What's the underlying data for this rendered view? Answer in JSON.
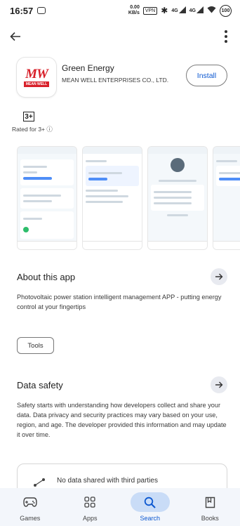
{
  "status_bar": {
    "time": "16:57",
    "net_speed_top": "0.00",
    "net_speed_bottom": "KB/s",
    "vpn": "VPN",
    "signal_1": "4G",
    "signal_2": "4G",
    "battery": "100"
  },
  "app": {
    "name": "Green Energy",
    "developer": "MEAN WELL ENTERPRISES CO., LTD.",
    "logo_text": "MW",
    "logo_sub": "MEAN WELL",
    "install_label": "Install",
    "rating_badge": "3+",
    "rating_text": "Rated for 3+ ⓘ"
  },
  "about": {
    "title": "About this app",
    "description": "Photovoltaic power station intelligent management APP - putting energy control at your fingertips",
    "tag": "Tools"
  },
  "safety": {
    "title": "Data safety",
    "description": "Safety starts with understanding how developers collect and share your data. Data privacy and security practices may vary based on your use, region, and age. The developer provided this information and may update it over time.",
    "item": "No data shared with third parties"
  },
  "nav": {
    "items": [
      {
        "label": "Games",
        "icon": "games-icon"
      },
      {
        "label": "Apps",
        "icon": "apps-icon"
      },
      {
        "label": "Search",
        "icon": "search-icon",
        "active": true
      },
      {
        "label": "Books",
        "icon": "books-icon"
      }
    ]
  },
  "colors": {
    "accent": "#0b57d0",
    "nav_active_bg": "#c9dcf7",
    "logo_red": "#d8202a"
  }
}
